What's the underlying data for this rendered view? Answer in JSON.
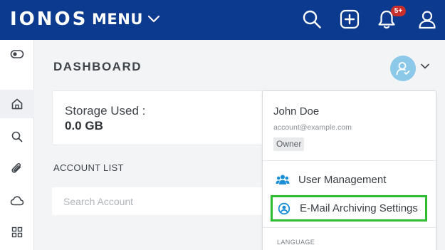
{
  "header": {
    "logo": "IONOS",
    "menu_label": "MENU",
    "notification_badge": "5+"
  },
  "rail": {
    "items": [
      "toggle-icon",
      "home-icon",
      "search-icon",
      "attachment-icon",
      "cloud-icon",
      "apps-grid-icon"
    ],
    "active": "home-icon"
  },
  "main": {
    "title": "DASHBOARD",
    "storage": {
      "label": "Storage Used :",
      "value": "0.0 GB"
    },
    "account_list": {
      "label": "ACCOUNT LIST",
      "search_placeholder": "Search Account"
    }
  },
  "user_menu": {
    "name": "John Doe",
    "email": "account@example.com",
    "role": "Owner",
    "items": [
      {
        "label": "User Management",
        "icon": "users-icon"
      },
      {
        "label": "E-Mail Archiving Settings",
        "icon": "user-circle-icon",
        "highlighted": true
      }
    ],
    "language_label": "LANGUAGE"
  },
  "colors": {
    "header_bg": "#0b3a8e",
    "avatar_bg": "#8cc8e8",
    "accent_blue": "#1a8fd6",
    "highlight_border": "#2ebd2e",
    "badge_red": "#c9302c"
  }
}
